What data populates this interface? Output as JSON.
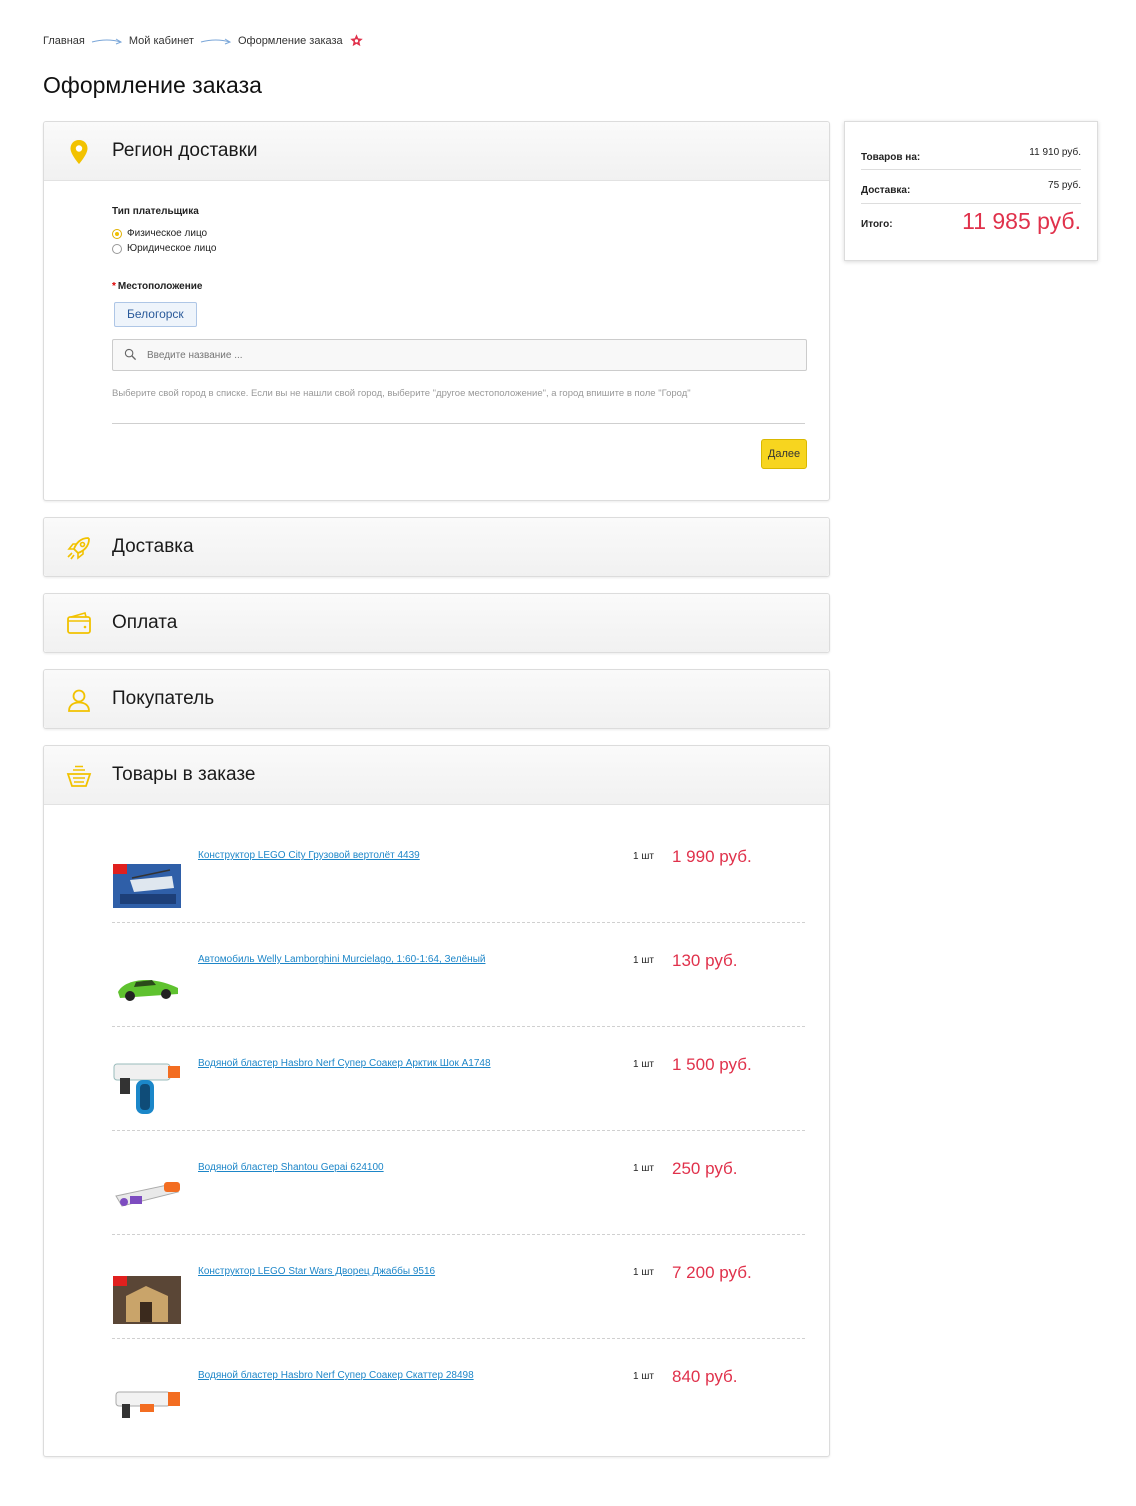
{
  "breadcrumb": {
    "items": [
      "Главная",
      "Мой кабинет",
      "Оформление заказа"
    ]
  },
  "page": {
    "title": "Оформление заказа"
  },
  "region": {
    "title": "Регион доставки",
    "payer_type_label": "Тип плательщика",
    "payer_options": [
      "Физическое лицо",
      "Юридическое лицо"
    ],
    "payer_selected": "Физическое лицо",
    "location_label": "Местоположение",
    "required_mark": "*",
    "city": "Белогорск",
    "search_placeholder": "Введите название ...",
    "hint": "Выберите свой город в списке. Если вы не нашли свой город, выберите \"другое местоположение\", а город впишите в поле \"Город\"",
    "next_label": "Далее"
  },
  "sections": {
    "delivery": "Доставка",
    "payment": "Оплата",
    "buyer": "Покупатель",
    "items": "Товары в заказе"
  },
  "items": [
    {
      "name": "Конструктор LEGO City Грузовой вертолёт 4439",
      "qty": "1 шт",
      "price": "1 990 руб."
    },
    {
      "name": "Автомобиль Welly Lamborghini Murcielago, 1:60-1:64, Зелёный",
      "qty": "1 шт",
      "price": "130 руб."
    },
    {
      "name": "Водяной бластер Hasbro Nerf Супер Соакер Арктик Шок A1748",
      "qty": "1 шт",
      "price": "1 500 руб."
    },
    {
      "name": "Водяной бластер Shantou Gepai 624100",
      "qty": "1 шт",
      "price": "250 руб."
    },
    {
      "name": "Конструктор LEGO Star Wars Дворец Джаббы 9516",
      "qty": "1 шт",
      "price": "7 200 руб."
    },
    {
      "name": "Водяной бластер Hasbro Nerf Супер Соакер Скаттер 28498",
      "qty": "1 шт",
      "price": "840 руб."
    }
  ],
  "summary": {
    "goods_label": "Товаров на:",
    "goods_value": "11 910 руб.",
    "delivery_label": "Доставка:",
    "delivery_value": "75 руб.",
    "total_label": "Итого:",
    "total_value": "11 985 руб."
  },
  "colors": {
    "accent": "#f7d51f",
    "icon": "#f2c200",
    "price": "#e0314b",
    "link": "#1d86c8"
  }
}
